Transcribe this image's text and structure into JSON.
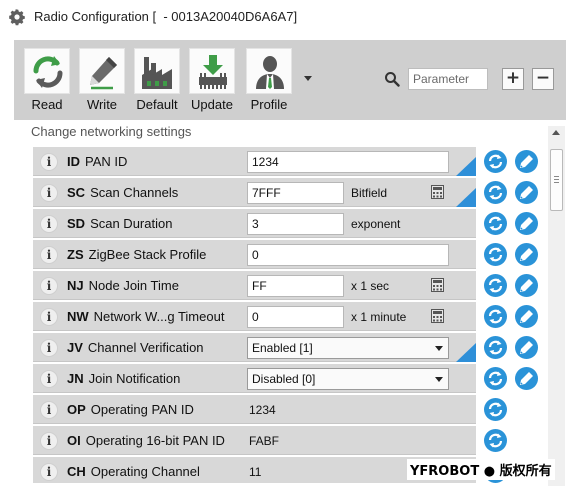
{
  "window": {
    "title": "Radio Configuration [  - 0013A20040D6A6A7]"
  },
  "toolbar": {
    "buttons": [
      {
        "label": "Read",
        "icon": "read-icon"
      },
      {
        "label": "Write",
        "icon": "write-icon"
      },
      {
        "label": "Default",
        "icon": "default-icon"
      },
      {
        "label": "Update",
        "icon": "update-icon"
      },
      {
        "label": "Profile",
        "icon": "profile-icon"
      }
    ],
    "search_placeholder": "Parameter",
    "expand_label": "+",
    "collapse_label": "−"
  },
  "section": {
    "header": "Change networking settings"
  },
  "params": [
    {
      "code": "ID",
      "name": "PAN ID",
      "value": "1234",
      "unit": ""
    },
    {
      "code": "SC",
      "name": "Scan Channels",
      "value": "7FFF",
      "unit": "Bitfield"
    },
    {
      "code": "SD",
      "name": "Scan Duration",
      "value": "3",
      "unit": "exponent"
    },
    {
      "code": "ZS",
      "name": "ZigBee Stack Profile",
      "value": "0",
      "unit": ""
    },
    {
      "code": "NJ",
      "name": "Node Join Time",
      "value": "FF",
      "unit": "x 1 sec"
    },
    {
      "code": "NW",
      "name": "Network W...g Timeout",
      "value": "0",
      "unit": "x 1 minute"
    },
    {
      "code": "JV",
      "name": "Channel Verification",
      "value": "Enabled [1]",
      "unit": ""
    },
    {
      "code": "JN",
      "name": "Join Notification",
      "value": "Disabled [0]",
      "unit": ""
    },
    {
      "code": "OP",
      "name": "Operating PAN ID",
      "value": "1234",
      "unit": ""
    },
    {
      "code": "OI",
      "name": "Operating 16-bit PAN ID",
      "value": "FABF",
      "unit": ""
    },
    {
      "code": "CH",
      "name": "Operating Channel",
      "value": "11",
      "unit": ""
    }
  ],
  "info_glyph": "i",
  "watermark": "YFROBOT ● 版权所有",
  "colors": {
    "accent": "#2a93d8",
    "toolbar_bg": "#cfcfcf",
    "row_bg": "#d8d8d8"
  }
}
